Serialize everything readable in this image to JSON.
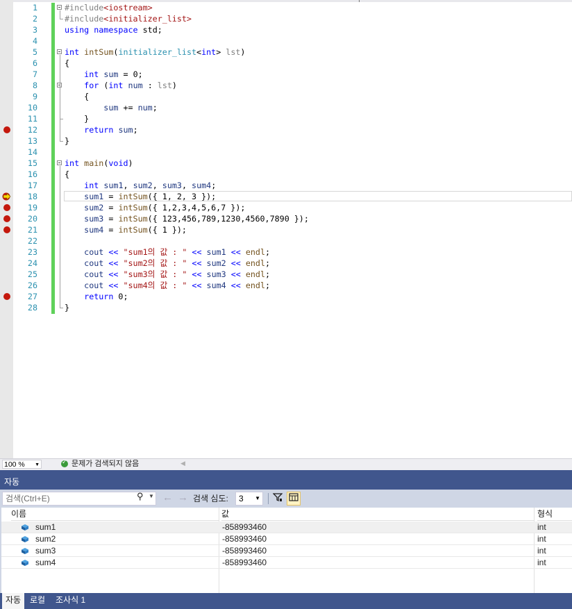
{
  "editor": {
    "lines": [
      {
        "n": "1",
        "bp": false,
        "arrow": false,
        "fold": true,
        "html": [
          {
            "c": "pp",
            "t": "#include"
          },
          {
            "c": "inc",
            "t": "<iostream>"
          }
        ]
      },
      {
        "n": "2",
        "bp": false,
        "arrow": false,
        "fold": false,
        "html": [
          {
            "c": "pp",
            "t": "#include"
          },
          {
            "c": "inc",
            "t": "<initializer_list>"
          }
        ]
      },
      {
        "n": "3",
        "bp": false,
        "arrow": false,
        "fold": false,
        "html": [
          {
            "c": "kw",
            "t": "using"
          },
          {
            "c": "",
            "t": " "
          },
          {
            "c": "kw",
            "t": "namespace"
          },
          {
            "c": "",
            "t": " std;"
          }
        ]
      },
      {
        "n": "4",
        "bp": false,
        "arrow": false,
        "fold": false,
        "html": []
      },
      {
        "n": "5",
        "bp": false,
        "arrow": false,
        "fold": true,
        "html": [
          {
            "c": "kw",
            "t": "int"
          },
          {
            "c": "",
            "t": " "
          },
          {
            "c": "fn",
            "t": "intSum"
          },
          {
            "c": "",
            "t": "("
          },
          {
            "c": "ty",
            "t": "initializer_list"
          },
          {
            "c": "",
            "t": "<"
          },
          {
            "c": "kw",
            "t": "int"
          },
          {
            "c": "",
            "t": "> "
          },
          {
            "c": "par",
            "t": "lst"
          },
          {
            "c": "",
            "t": ")"
          }
        ]
      },
      {
        "n": "6",
        "bp": false,
        "arrow": false,
        "fold": false,
        "html": [
          {
            "c": "",
            "t": "{"
          }
        ]
      },
      {
        "n": "7",
        "bp": false,
        "arrow": false,
        "fold": false,
        "html": [
          {
            "c": "",
            "t": "    "
          },
          {
            "c": "kw",
            "t": "int"
          },
          {
            "c": "",
            "t": " "
          },
          {
            "c": "var",
            "t": "sum"
          },
          {
            "c": "",
            "t": " = 0;"
          }
        ]
      },
      {
        "n": "8",
        "bp": false,
        "arrow": false,
        "fold": true,
        "html": [
          {
            "c": "",
            "t": "    "
          },
          {
            "c": "kw",
            "t": "for"
          },
          {
            "c": "",
            "t": " ("
          },
          {
            "c": "kw",
            "t": "int"
          },
          {
            "c": "",
            "t": " "
          },
          {
            "c": "var",
            "t": "num"
          },
          {
            "c": "",
            "t": " : "
          },
          {
            "c": "par",
            "t": "lst"
          },
          {
            "c": "",
            "t": ")"
          }
        ]
      },
      {
        "n": "9",
        "bp": false,
        "arrow": false,
        "fold": false,
        "html": [
          {
            "c": "",
            "t": "    {"
          }
        ]
      },
      {
        "n": "10",
        "bp": false,
        "arrow": false,
        "fold": false,
        "html": [
          {
            "c": "",
            "t": "        "
          },
          {
            "c": "var",
            "t": "sum"
          },
          {
            "c": "",
            "t": " += "
          },
          {
            "c": "var",
            "t": "num"
          },
          {
            "c": "",
            "t": ";"
          }
        ]
      },
      {
        "n": "11",
        "bp": false,
        "arrow": false,
        "fold": false,
        "html": [
          {
            "c": "",
            "t": "    }"
          }
        ]
      },
      {
        "n": "12",
        "bp": true,
        "arrow": false,
        "fold": false,
        "html": [
          {
            "c": "",
            "t": "    "
          },
          {
            "c": "kw",
            "t": "return"
          },
          {
            "c": "",
            "t": " "
          },
          {
            "c": "var",
            "t": "sum"
          },
          {
            "c": "",
            "t": ";"
          }
        ]
      },
      {
        "n": "13",
        "bp": false,
        "arrow": false,
        "fold": false,
        "html": [
          {
            "c": "",
            "t": "}"
          }
        ]
      },
      {
        "n": "14",
        "bp": false,
        "arrow": false,
        "fold": false,
        "html": []
      },
      {
        "n": "15",
        "bp": false,
        "arrow": false,
        "fold": true,
        "html": [
          {
            "c": "kw",
            "t": "int"
          },
          {
            "c": "",
            "t": " "
          },
          {
            "c": "fn",
            "t": "main"
          },
          {
            "c": "",
            "t": "("
          },
          {
            "c": "kw",
            "t": "void"
          },
          {
            "c": "",
            "t": ")"
          }
        ]
      },
      {
        "n": "16",
        "bp": false,
        "arrow": false,
        "fold": false,
        "html": [
          {
            "c": "",
            "t": "{"
          }
        ]
      },
      {
        "n": "17",
        "bp": false,
        "arrow": false,
        "fold": false,
        "html": [
          {
            "c": "",
            "t": "    "
          },
          {
            "c": "kw",
            "t": "int"
          },
          {
            "c": "",
            "t": " "
          },
          {
            "c": "var",
            "t": "sum1"
          },
          {
            "c": "",
            "t": ", "
          },
          {
            "c": "var",
            "t": "sum2"
          },
          {
            "c": "",
            "t": ", "
          },
          {
            "c": "var",
            "t": "sum3"
          },
          {
            "c": "",
            "t": ", "
          },
          {
            "c": "var",
            "t": "sum4"
          },
          {
            "c": "",
            "t": ";"
          }
        ]
      },
      {
        "n": "18",
        "bp": false,
        "arrow": true,
        "fold": false,
        "html": [
          {
            "c": "",
            "t": "    "
          },
          {
            "c": "var",
            "t": "sum1"
          },
          {
            "c": "",
            "t": " = "
          },
          {
            "c": "fn",
            "t": "intSum"
          },
          {
            "c": "",
            "t": "({ 1, 2, 3 });"
          }
        ]
      },
      {
        "n": "19",
        "bp": true,
        "arrow": false,
        "fold": false,
        "html": [
          {
            "c": "",
            "t": "    "
          },
          {
            "c": "var",
            "t": "sum2"
          },
          {
            "c": "",
            "t": " = "
          },
          {
            "c": "fn",
            "t": "intSum"
          },
          {
            "c": "",
            "t": "({ 1,2,3,4,5,6,7 });"
          }
        ]
      },
      {
        "n": "20",
        "bp": true,
        "arrow": false,
        "fold": false,
        "html": [
          {
            "c": "",
            "t": "    "
          },
          {
            "c": "var",
            "t": "sum3"
          },
          {
            "c": "",
            "t": " = "
          },
          {
            "c": "fn",
            "t": "intSum"
          },
          {
            "c": "",
            "t": "({ 123,456,789,1230,4560,7890 });"
          }
        ]
      },
      {
        "n": "21",
        "bp": true,
        "arrow": false,
        "fold": false,
        "html": [
          {
            "c": "",
            "t": "    "
          },
          {
            "c": "var",
            "t": "sum4"
          },
          {
            "c": "",
            "t": " = "
          },
          {
            "c": "fn",
            "t": "intSum"
          },
          {
            "c": "",
            "t": "({ 1 });"
          }
        ]
      },
      {
        "n": "22",
        "bp": false,
        "arrow": false,
        "fold": false,
        "html": []
      },
      {
        "n": "23",
        "bp": false,
        "arrow": false,
        "fold": false,
        "html": [
          {
            "c": "",
            "t": "    "
          },
          {
            "c": "var",
            "t": "cout"
          },
          {
            "c": "",
            "t": " "
          },
          {
            "c": "kw",
            "t": "<<"
          },
          {
            "c": "",
            "t": " "
          },
          {
            "c": "str",
            "t": "\"sum1의 값 : \""
          },
          {
            "c": "",
            "t": " "
          },
          {
            "c": "kw",
            "t": "<<"
          },
          {
            "c": "",
            "t": " "
          },
          {
            "c": "var",
            "t": "sum1"
          },
          {
            "c": "",
            "t": " "
          },
          {
            "c": "kw",
            "t": "<<"
          },
          {
            "c": "",
            "t": " "
          },
          {
            "c": "fn",
            "t": "endl"
          },
          {
            "c": "",
            "t": ";"
          }
        ]
      },
      {
        "n": "24",
        "bp": false,
        "arrow": false,
        "fold": false,
        "html": [
          {
            "c": "",
            "t": "    "
          },
          {
            "c": "var",
            "t": "cout"
          },
          {
            "c": "",
            "t": " "
          },
          {
            "c": "kw",
            "t": "<<"
          },
          {
            "c": "",
            "t": " "
          },
          {
            "c": "str",
            "t": "\"sum2의 값 : \""
          },
          {
            "c": "",
            "t": " "
          },
          {
            "c": "kw",
            "t": "<<"
          },
          {
            "c": "",
            "t": " "
          },
          {
            "c": "var",
            "t": "sum2"
          },
          {
            "c": "",
            "t": " "
          },
          {
            "c": "kw",
            "t": "<<"
          },
          {
            "c": "",
            "t": " "
          },
          {
            "c": "fn",
            "t": "endl"
          },
          {
            "c": "",
            "t": ";"
          }
        ]
      },
      {
        "n": "25",
        "bp": false,
        "arrow": false,
        "fold": false,
        "html": [
          {
            "c": "",
            "t": "    "
          },
          {
            "c": "var",
            "t": "cout"
          },
          {
            "c": "",
            "t": " "
          },
          {
            "c": "kw",
            "t": "<<"
          },
          {
            "c": "",
            "t": " "
          },
          {
            "c": "str",
            "t": "\"sum3의 값 : \""
          },
          {
            "c": "",
            "t": " "
          },
          {
            "c": "kw",
            "t": "<<"
          },
          {
            "c": "",
            "t": " "
          },
          {
            "c": "var",
            "t": "sum3"
          },
          {
            "c": "",
            "t": " "
          },
          {
            "c": "kw",
            "t": "<<"
          },
          {
            "c": "",
            "t": " "
          },
          {
            "c": "fn",
            "t": "endl"
          },
          {
            "c": "",
            "t": ";"
          }
        ]
      },
      {
        "n": "26",
        "bp": false,
        "arrow": false,
        "fold": false,
        "html": [
          {
            "c": "",
            "t": "    "
          },
          {
            "c": "var",
            "t": "cout"
          },
          {
            "c": "",
            "t": " "
          },
          {
            "c": "kw",
            "t": "<<"
          },
          {
            "c": "",
            "t": " "
          },
          {
            "c": "str",
            "t": "\"sum4의 값 : \""
          },
          {
            "c": "",
            "t": " "
          },
          {
            "c": "kw",
            "t": "<<"
          },
          {
            "c": "",
            "t": " "
          },
          {
            "c": "var",
            "t": "sum4"
          },
          {
            "c": "",
            "t": " "
          },
          {
            "c": "kw",
            "t": "<<"
          },
          {
            "c": "",
            "t": " "
          },
          {
            "c": "fn",
            "t": "endl"
          },
          {
            "c": "",
            "t": ";"
          }
        ]
      },
      {
        "n": "27",
        "bp": true,
        "arrow": false,
        "fold": false,
        "html": [
          {
            "c": "",
            "t": "    "
          },
          {
            "c": "kw",
            "t": "return"
          },
          {
            "c": "",
            "t": " 0;"
          }
        ]
      },
      {
        "n": "28",
        "bp": false,
        "arrow": false,
        "fold": false,
        "html": [
          {
            "c": "",
            "t": "}"
          }
        ]
      }
    ]
  },
  "statusbar": {
    "zoom": "100 %",
    "issues_text": "문제가 검색되지 않음"
  },
  "auto_window": {
    "title": "자동",
    "search_placeholder": "검색(Ctrl+E)",
    "depth_label": "검색 심도:",
    "depth_value": "3",
    "columns": {
      "name": "이름",
      "value": "값",
      "type": "형식"
    },
    "rows": [
      {
        "name": "sum1",
        "value": "-858993460",
        "type": "int"
      },
      {
        "name": "sum2",
        "value": "-858993460",
        "type": "int"
      },
      {
        "name": "sum3",
        "value": "-858993460",
        "type": "int"
      },
      {
        "name": "sum4",
        "value": "-858993460",
        "type": "int"
      }
    ]
  },
  "bottom_tabs": [
    {
      "label": "자동",
      "active": true
    },
    {
      "label": "로컬",
      "active": false
    },
    {
      "label": "조사식 1",
      "active": false
    }
  ],
  "colors": {
    "keyword": "#0000ff",
    "string": "#a31515",
    "line_number": "#2b91af",
    "breakpoint": "#c4180d",
    "panel_header": "#40568d",
    "change_bar": "#5fd15a"
  }
}
